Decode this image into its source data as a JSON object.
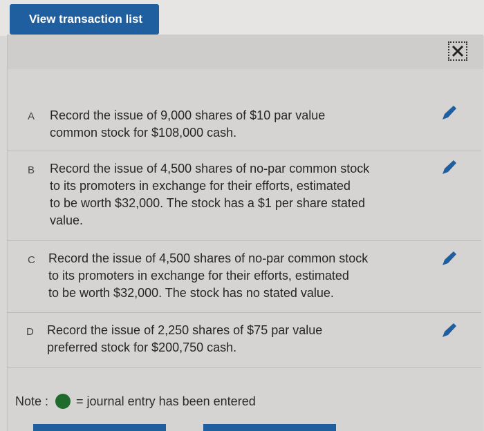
{
  "toolbar": {
    "view_transactions_label": "View transaction list"
  },
  "icons": {
    "close": "close-icon",
    "edit": "pencil-icon"
  },
  "colors": {
    "accent": "#1f5f9f",
    "entered_dot": "#1f6b2c"
  },
  "transactions": [
    {
      "letter": "A",
      "lines": [
        "Record the issue of 9,000 shares of $10 par value",
        "common stock for $108,000 cash."
      ]
    },
    {
      "letter": "B",
      "lines": [
        "Record the issue of 4,500 shares of no-par common stock",
        "to its promoters in exchange for their efforts, estimated",
        "to be worth $32,000. The stock has a $1 per share stated",
        "value."
      ]
    },
    {
      "letter": "C",
      "lines": [
        "Record the issue of 4,500 shares of no-par common stock",
        "to its promoters in exchange for their efforts, estimated",
        "to be worth $32,000. The stock has no stated value."
      ]
    },
    {
      "letter": "D",
      "lines": [
        "Record the issue of 2,250 shares of $75 par value",
        "preferred stock for $200,750 cash."
      ]
    }
  ],
  "note": {
    "label": "Note :",
    "text": "= journal entry has been entered"
  }
}
